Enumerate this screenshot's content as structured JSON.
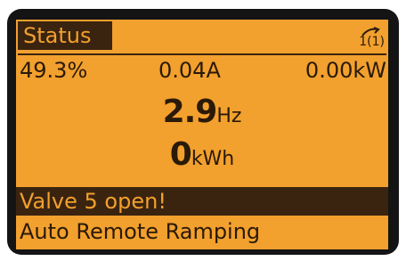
{
  "header": {
    "title": "Status",
    "menu_index": "1(1)",
    "menu_icon": "return-arrow-icon"
  },
  "readings": {
    "speed_percent": "49.3%",
    "current": "0.04A",
    "power": "0.00kW"
  },
  "main": {
    "frequency_value": "2.9",
    "frequency_unit": "Hz",
    "energy_value": "0",
    "energy_unit": "kWh"
  },
  "messages": {
    "warning": "Valve 5 open!",
    "status": "Auto Remote Ramping"
  },
  "colors": {
    "screen_background": "#f2a02e",
    "text_dark": "#2a1a08",
    "highlight_bar": "#3a2410"
  }
}
